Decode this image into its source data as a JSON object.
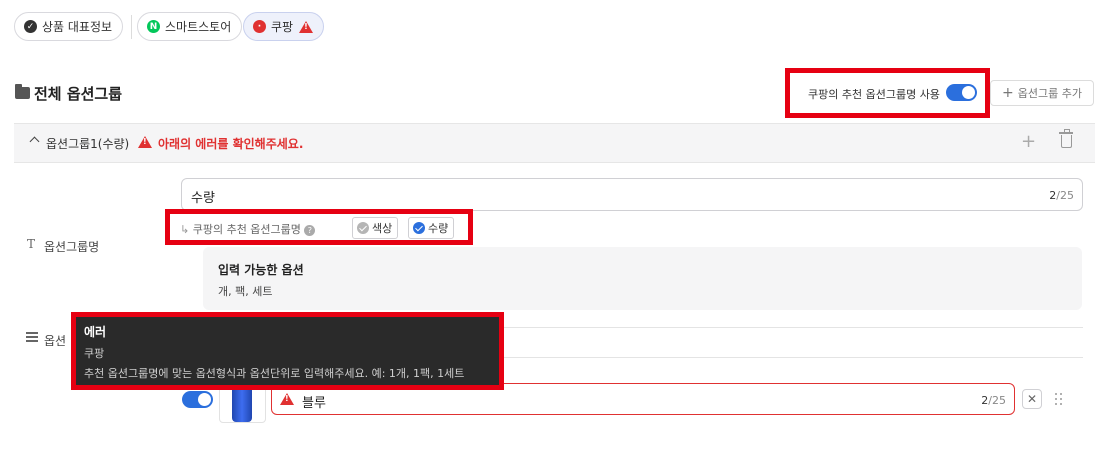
{
  "tabs": [
    {
      "label": "상품 대표정보",
      "icon": "check-circle-icon",
      "icon_color": "#333333"
    },
    {
      "label": "스마트스토어",
      "icon": "naver-n-icon",
      "icon_color": "#03c75a"
    },
    {
      "label": "쿠팡",
      "icon": "coupang-icon",
      "icon_color": "#e03131",
      "warning": true
    }
  ],
  "section": {
    "title": "전체 옵션그룹"
  },
  "header_actions": {
    "recommend_toggle_label": "쿠팡의 추천 옵션그룹명 사용",
    "recommend_toggle_on": true,
    "add_group_label": "옵션그룹 추가"
  },
  "group": {
    "name": "옵션그룹1(수량)",
    "error_text": "아래의 에러를 확인해주세요."
  },
  "group_name_field": {
    "label": "옵션그룹명",
    "value": "수량",
    "count": "2",
    "max": "/25"
  },
  "recommend": {
    "prefix": "↳",
    "label": "쿠팡의 추천 옵션그룹명",
    "help": "?",
    "chips": [
      {
        "label": "색상",
        "selected": false
      },
      {
        "label": "수량",
        "selected": true
      }
    ]
  },
  "info": {
    "title": "입력 가능한 옵션",
    "body": "개, 팩, 세트"
  },
  "option_label": "옵션",
  "tooltip": {
    "title": "에러",
    "source": "쿠팡",
    "message": "추천 옵션그룹명에 맞는 옵션형식과 옵션단위로 입력해주세요. 예: 1개, 1팩, 1세트"
  },
  "option_value": {
    "enabled": true,
    "value": "블루",
    "count": "2",
    "max": "/25",
    "remove": "✕"
  },
  "colors": {
    "accent": "#2b6fdd",
    "error": "#e03131",
    "highlight": "#e60012"
  }
}
